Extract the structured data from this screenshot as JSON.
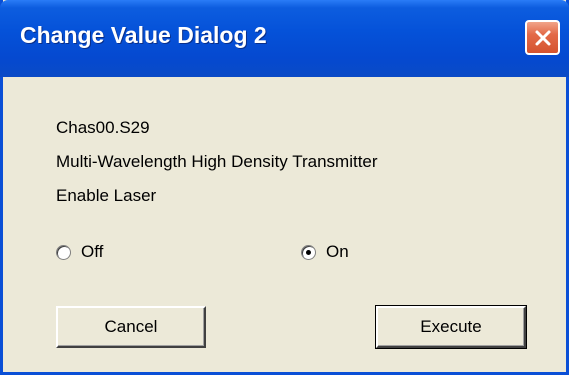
{
  "window": {
    "title": "Change Value Dialog 2"
  },
  "info": {
    "chassis": "Chas00.S29",
    "module": "Multi-Wavelength High Density Transmitter",
    "parameter": "Enable Laser"
  },
  "options": [
    {
      "label": "Off",
      "selected": false
    },
    {
      "label": "On",
      "selected": true
    }
  ],
  "buttons": {
    "cancel": "Cancel",
    "execute": "Execute"
  },
  "colors": {
    "titlebar": "#0552d9",
    "close": "#e36a48",
    "background": "#ece9d8"
  },
  "icons": {
    "close": "close-icon"
  }
}
